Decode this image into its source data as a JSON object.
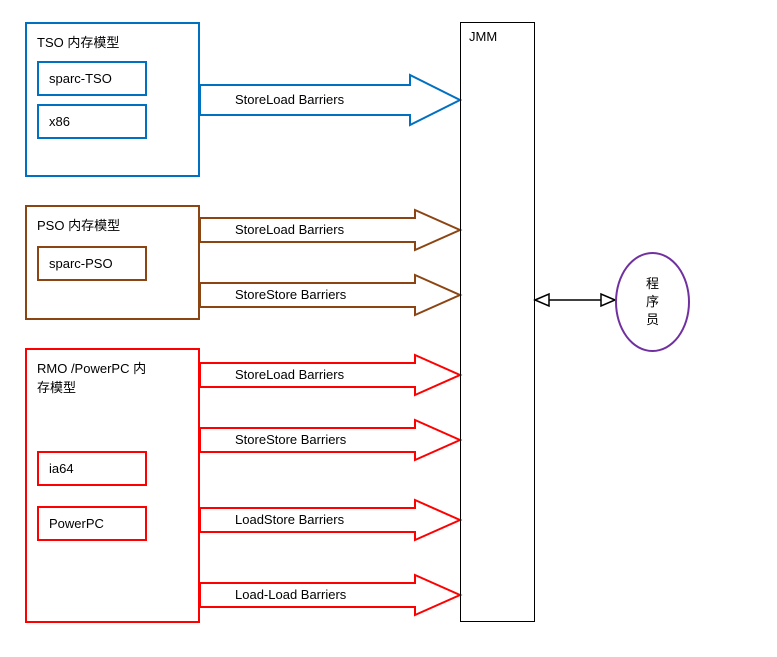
{
  "tso": {
    "title": "TSO 内存模型",
    "items": [
      "sparc-TSO",
      "x86"
    ],
    "color": "#0070c0",
    "barriers": [
      "StoreLoad Barriers"
    ]
  },
  "pso": {
    "title": "PSO 内存模型",
    "items": [
      "sparc-PSO"
    ],
    "color": "#8b4513",
    "barriers": [
      "StoreLoad Barriers",
      "StoreStore Barriers"
    ]
  },
  "rmo": {
    "title": "RMO /PowerPC 内存模型",
    "items": [
      "ia64",
      "PowerPC"
    ],
    "color": "#ff0000",
    "barriers": [
      "StoreLoad Barriers",
      "StoreStore Barriers",
      "LoadStore Barriers",
      "Load-Load Barriers"
    ]
  },
  "jmm": {
    "label": "JMM"
  },
  "programmer": {
    "label_lines": [
      "程",
      "序",
      "员"
    ]
  }
}
